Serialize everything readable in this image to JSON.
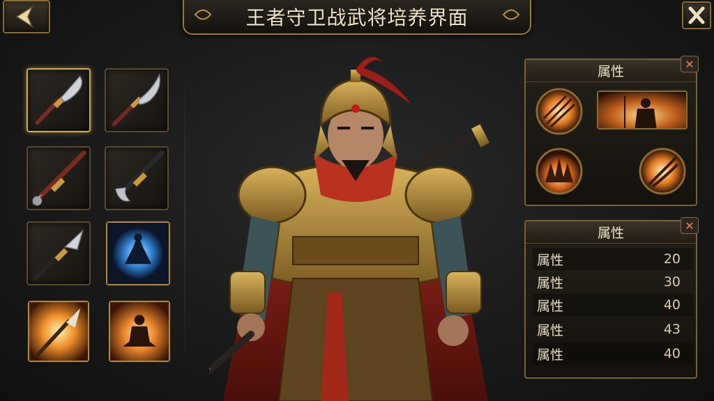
{
  "header": {
    "title": "王者守卫战武将培养界面"
  },
  "equipment": {
    "slots": [
      {
        "name": "broadsword",
        "selected": true
      },
      {
        "name": "curved-glaive"
      },
      {
        "name": "red-shaft-spear"
      },
      {
        "name": "black-iron-spear"
      },
      {
        "name": "spearhead"
      },
      {
        "name": "meditation-blue-skill"
      },
      {
        "name": "flaming-spear-skill"
      },
      {
        "name": "meditation-fire-skill"
      }
    ]
  },
  "skill_panel": {
    "title": "属性",
    "close_glyph": "✕"
  },
  "stats_panel": {
    "title": "属性",
    "close_glyph": "✕",
    "rows": [
      {
        "label": "属性",
        "value": "20"
      },
      {
        "label": "属性",
        "value": "30"
      },
      {
        "label": "属性",
        "value": "40"
      },
      {
        "label": "属性",
        "value": "43"
      },
      {
        "label": "属性",
        "value": "40"
      }
    ]
  },
  "colors": {
    "gold": "#d4aa52",
    "bronze": "#8a6b34",
    "red_cloth": "#b8321f",
    "fire": "#f0902a"
  }
}
